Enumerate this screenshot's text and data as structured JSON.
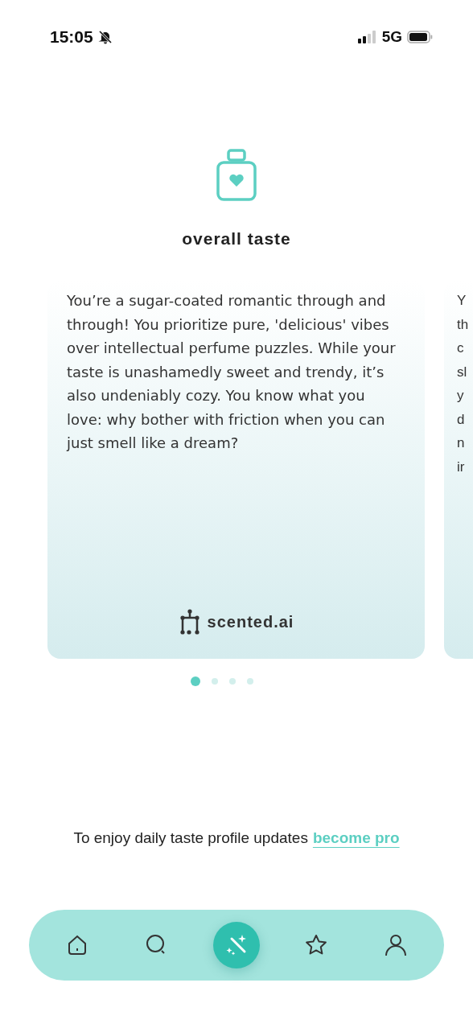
{
  "status_bar": {
    "time": "15:05",
    "network": "5G"
  },
  "header": {
    "title": "overall taste"
  },
  "cards": [
    {
      "text": "You’re a sugar-coated romantic through and through! You prioritize pure, 'delicious' vibes over intellectual perfume puzzles. While your taste is unashamedly sweet and trendy, it’s also undeniably cozy. You know what you love: why bother with friction when you can just smell like a dream?",
      "brand": "scented.ai"
    },
    {
      "lines": [
        "Y",
        "th",
        "c",
        "sl",
        "y",
        "d",
        "n",
        "ir"
      ]
    }
  ],
  "pager": [
    {
      "selected": true
    },
    {
      "selected": false
    },
    {
      "selected": false
    },
    {
      "selected": false
    }
  ],
  "promo": {
    "text": "To enjoy daily taste profile updates",
    "link": "become pro"
  },
  "nav": [
    {
      "kind": "home",
      "selected": false
    },
    {
      "kind": "search",
      "selected": false
    },
    {
      "kind": "magic",
      "selected": true
    },
    {
      "kind": "favorites",
      "selected": false
    },
    {
      "kind": "profile",
      "selected": false
    }
  ]
}
